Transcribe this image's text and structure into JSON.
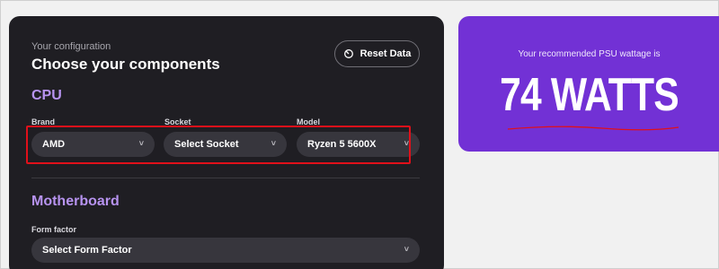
{
  "config": {
    "subtitle": "Your configuration",
    "title": "Choose your components",
    "reset_label": "Reset Data",
    "reset_icon": "refresh-icon"
  },
  "cpu": {
    "heading": "CPU",
    "brand": {
      "label": "Brand",
      "value": "AMD"
    },
    "socket": {
      "label": "Socket",
      "value": "Select Socket"
    },
    "model": {
      "label": "Model",
      "value": "Ryzen 5 5600X"
    }
  },
  "motherboard": {
    "heading": "Motherboard",
    "form_factor": {
      "label": "Form factor",
      "value": "Select Form Factor"
    }
  },
  "result": {
    "label": "Your recommended PSU wattage is",
    "value": "74 WATTS"
  },
  "colors": {
    "panel": "#1f1e23",
    "accent": "#b793f0",
    "result_bg": "#7231d5",
    "highlight": "#e0101a"
  }
}
